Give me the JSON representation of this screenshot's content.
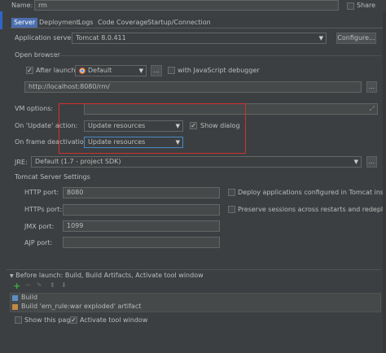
{
  "colors": {
    "background": "#3c3f41",
    "field": "#45494a",
    "accent_tab": "#4b6eaf",
    "highlight_box": "#d03030",
    "dim_text": "#7f7f7f"
  },
  "top": {
    "name_label": "Name:",
    "name_value": "rm",
    "share_label": "Share"
  },
  "tabs": [
    {
      "label": "Server",
      "selected": true
    },
    {
      "label": "Deployment"
    },
    {
      "label": "Logs"
    },
    {
      "label": "Code Coverage"
    },
    {
      "label": "Startup/Connection"
    }
  ],
  "server": {
    "app_server_label": "Application server:",
    "app_server_value": "Tomcat 8.0.411",
    "configure_label": "Configure...",
    "open_browser_title": "Open browser",
    "after_launch_label": "After launch",
    "browser_value": "Default",
    "more_label": "...",
    "js_debugger_label": "with JavaScript debugger",
    "url_value": "http://localhost:8080/rm/",
    "vm_options_label": "VM options:",
    "on_update_label": "On 'Update' action:",
    "on_update_value": "Update resources",
    "show_dialog_label": "Show dialog",
    "on_frame_label": "On frame deactivation:",
    "on_frame_value": "Update resources",
    "jre_label": "JRE:",
    "jre_value": "Default (1.7 - project SDK)",
    "tomcat_settings_title": "Tomcat Server Settings",
    "http_port_label": "HTTP port:",
    "http_port_value": "8080",
    "https_port_label": "HTTPs port:",
    "https_port_value": "",
    "jmx_port_label": "JMX port:",
    "jmx_port_value": "1099",
    "ajp_port_label": "AJP port:",
    "ajp_port_value": "",
    "deploy_apps_label": "Deploy applications configured in Tomcat instance",
    "preserve_sessions_label": "Preserve sessions across restarts and redeploys"
  },
  "before_launch": {
    "title": "Before launch: Build, Build Artifacts, Activate tool window",
    "toolbar": [
      {
        "icon": "add-icon",
        "glyph": "+"
      },
      {
        "icon": "remove-icon",
        "glyph": "−"
      },
      {
        "icon": "edit-icon",
        "glyph": "✎"
      },
      {
        "icon": "move-up-icon",
        "glyph": "⬆"
      },
      {
        "icon": "move-down-icon",
        "glyph": "⬇"
      }
    ],
    "items": [
      {
        "label": "Build",
        "icon": "build-icon"
      },
      {
        "label": "Build 'em_rule:war exploded' artifact",
        "icon": "artifact-icon"
      }
    ],
    "show_page_label": "Show this page",
    "activate_tool_label": "Activate tool window"
  }
}
